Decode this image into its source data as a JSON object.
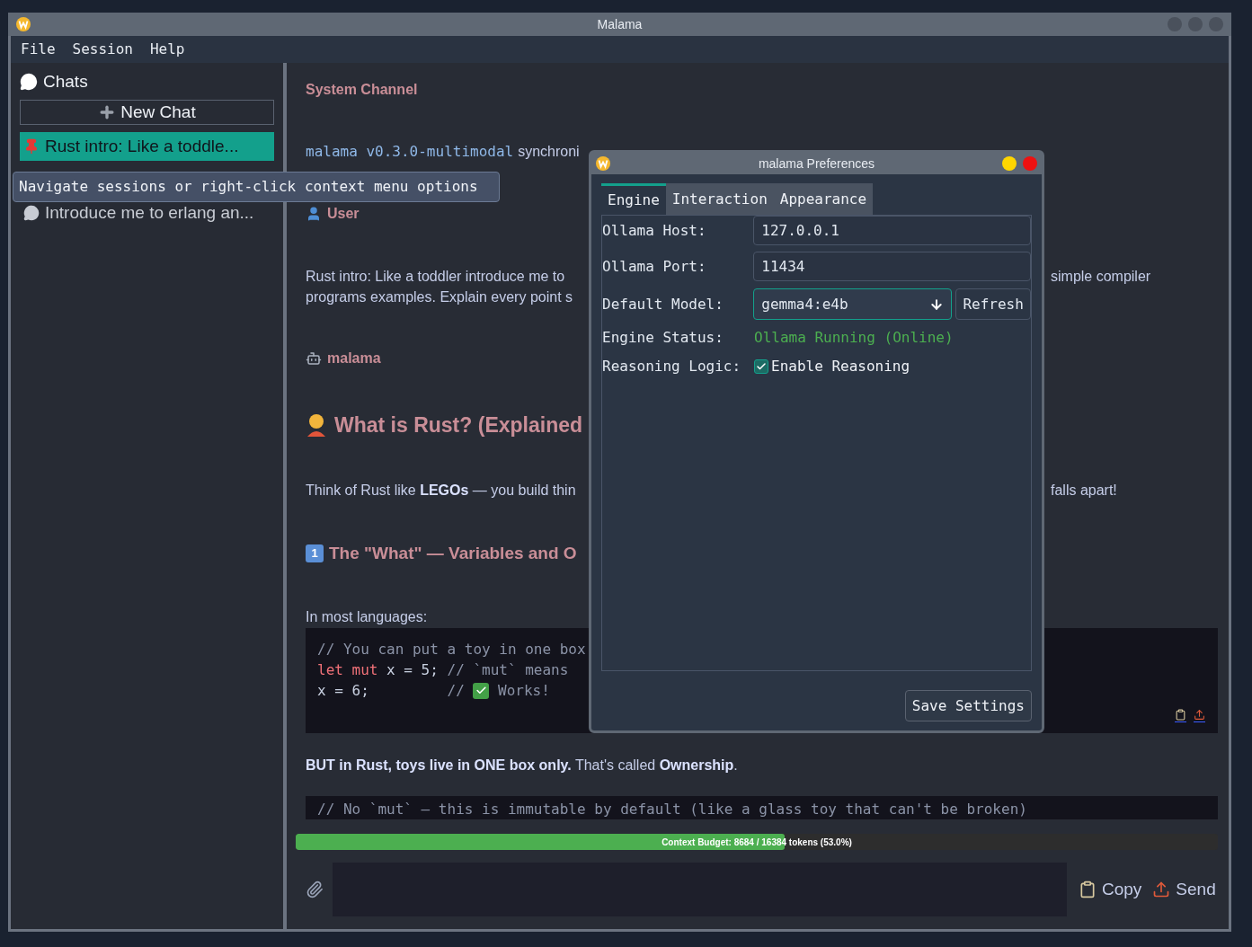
{
  "window": {
    "title": "Malama"
  },
  "menu": [
    "File",
    "Session",
    "Help"
  ],
  "sidebar": {
    "title": "Chats",
    "new_chat": "New Chat",
    "items": [
      {
        "label": "Rust intro: Like a toddle...",
        "kind": "pinned",
        "selected": true
      },
      {
        "label": "Introduce me to erlang an...",
        "kind": "chat",
        "selected": false
      }
    ],
    "tooltip": "Navigate sessions or right-click context menu options"
  },
  "chat": {
    "blocks": [
      {
        "kind": "channel",
        "text": "System Channel"
      },
      {
        "kind": "version",
        "code": "malama v0.3.0-multimodal",
        "text": "synchroni"
      },
      {
        "kind": "sender_user",
        "text": "User"
      },
      {
        "kind": "para2",
        "lines": [
          "Rust intro: Like a toddler introduce me to",
          "programs examples. Explain every point s"
        ],
        "right": "simple compiler"
      },
      {
        "kind": "sender_bot",
        "text": "malama"
      },
      {
        "kind": "heading",
        "text": "What is Rust? (Explained"
      },
      {
        "kind": "para",
        "text": "Think of Rust like **LEGOs** — you build thin",
        "right": "falls apart!"
      },
      {
        "kind": "subheading",
        "number": "1",
        "text": "The \"What\" — Variables and O"
      },
      {
        "kind": "plain",
        "text": "In most languages:"
      },
      {
        "kind": "code",
        "lines": [
          [
            {
              "t": "// You can put a toy in one box",
              "kind": "comment"
            }
          ],
          [
            {
              "t": "let mut",
              "kind": "keyword"
            },
            {
              "t": " x = 5; ",
              "kind": "plain"
            },
            {
              "t": "// `mut` means",
              "kind": "comment"
            }
          ],
          [
            {
              "t": "x = 6;         ",
              "kind": "plain"
            },
            {
              "t": "// ",
              "kind": "comment"
            },
            {
              "kind": "check"
            },
            {
              "t": " Works!",
              "kind": "comment"
            }
          ]
        ]
      },
      {
        "kind": "para",
        "text": "**BUT in Rust, toys live in ONE box only.** That's called **Ownership**."
      },
      {
        "kind": "code_cut",
        "lines": [
          [
            {
              "t": "// No `mut` — this is immutable by default (like a glass toy that can't be broken)",
              "kind": "comment"
            }
          ]
        ]
      }
    ]
  },
  "context": {
    "label": "Context Budget: 8684 / 16384 tokens (53.0%)",
    "level": 0.53
  },
  "actions": [
    "Copy",
    "Send"
  ],
  "dialog": {
    "title": "malama Preferences",
    "tabs": [
      {
        "label": "Engine",
        "selected": true
      },
      {
        "label": "Interaction",
        "selected": false
      },
      {
        "label": "Appearance",
        "selected": false
      }
    ],
    "host": {
      "label": "Ollama Host:",
      "value": "127.0.0.1"
    },
    "port": {
      "label": "Ollama Port:",
      "value": "11434"
    },
    "model": {
      "label": "Default Model:",
      "value": "gemma4:e4b",
      "button": "Refresh"
    },
    "status": {
      "label": "Engine Status:",
      "value": "Ollama Running (Online)",
      "color": "#4caf50"
    },
    "reasoning": {
      "label": "Reasoning Logic:",
      "option": "Enable Reasoning",
      "checked": true
    },
    "save": "Save Settings"
  }
}
